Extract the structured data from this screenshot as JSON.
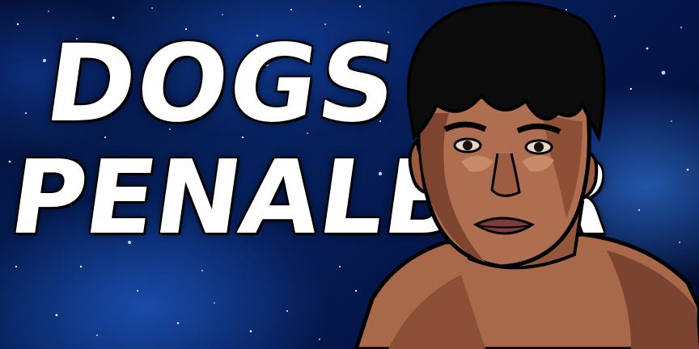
{
  "banner": {
    "title_line_1": "Dogs",
    "title_line_2": "Penalber"
  },
  "colors": {
    "space_dark": "#020b2a",
    "space_blue": "#06215e",
    "nebula_glow": "#3c8cff",
    "title_text": "#ffffff",
    "skin": "#b06e50",
    "skin_shadow": "#6e3a26",
    "hair": "#0b0b0b"
  },
  "icons": {
    "portrait": "cartoon-portrait-illustration"
  }
}
